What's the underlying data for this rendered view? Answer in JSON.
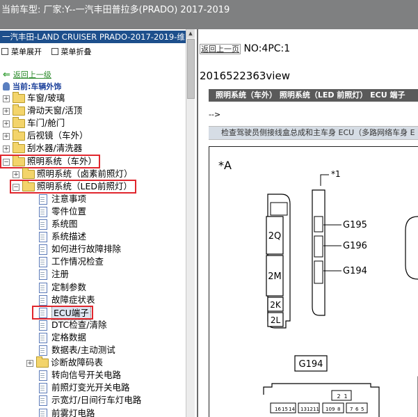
{
  "window": {
    "title": "当前车型:   厂家:Y--一汽丰田普拉多(PRADO) 2017-2019"
  },
  "left_panel": {
    "header": "一汽丰田-LAND CRUISER PRADO-2017-2019-维",
    "toolbar": {
      "expand": "菜单展开",
      "collapse": "菜单折叠"
    },
    "back_label": "返回上一级",
    "current_label": "当前:车辆外饰",
    "tree": [
      {
        "label": "车窗/玻璃",
        "type": "folder",
        "level": 0,
        "expander": "+"
      },
      {
        "label": "滑动天窗/活顶",
        "type": "folder",
        "level": 0,
        "expander": "+"
      },
      {
        "label": "车门/舱门",
        "type": "folder",
        "level": 0,
        "expander": "+"
      },
      {
        "label": "后视镜（车外）",
        "type": "folder",
        "level": 0,
        "expander": "+"
      },
      {
        "label": "刮水器/清洗器",
        "type": "folder",
        "level": 0,
        "expander": "+"
      },
      {
        "label": "照明系统（车外）",
        "type": "folder",
        "level": 0,
        "expander": "-",
        "highlight": true
      },
      {
        "label": "照明系统（卤素前照灯）",
        "type": "folder",
        "level": 1,
        "expander": "+"
      },
      {
        "label": "照明系统（LED前照灯）",
        "type": "folder",
        "level": 1,
        "expander": "-",
        "highlight": true
      },
      {
        "label": "注意事项",
        "type": "doc",
        "level": 2
      },
      {
        "label": "零件位置",
        "type": "doc",
        "level": 2
      },
      {
        "label": "系统图",
        "type": "doc",
        "level": 2
      },
      {
        "label": "系统描述",
        "type": "doc",
        "level": 2
      },
      {
        "label": "如何进行故障排除",
        "type": "doc",
        "level": 2
      },
      {
        "label": "工作情况检查",
        "type": "doc",
        "level": 2
      },
      {
        "label": "注册",
        "type": "doc",
        "level": 2
      },
      {
        "label": "定制参数",
        "type": "doc",
        "level": 2
      },
      {
        "label": "故障症状表",
        "type": "doc",
        "level": 2
      },
      {
        "label": "ECU端子",
        "type": "doc",
        "level": 2,
        "highlight": true,
        "selected": true
      },
      {
        "label": "DTC检查/清除",
        "type": "doc",
        "level": 2
      },
      {
        "label": "定格数据",
        "type": "doc",
        "level": 2
      },
      {
        "label": "数据表/主动测试",
        "type": "doc",
        "level": 2
      },
      {
        "label": "诊断故障码表",
        "type": "folder",
        "level": 2,
        "expander": "+"
      },
      {
        "label": "转向信号开关电路",
        "type": "doc",
        "level": 2
      },
      {
        "label": "前照灯变光开关电路",
        "type": "doc",
        "level": 2
      },
      {
        "label": "示宽灯/日间行车灯电路",
        "type": "doc",
        "level": 2
      },
      {
        "label": "前雾灯电路",
        "type": "doc",
        "level": 2
      }
    ]
  },
  "right_panel": {
    "back_link": "返回上一页",
    "no_label": "NO:4PC:1",
    "doc_id": "2016522363view",
    "section_title": "照明系统（车外） 照明系统（LED 前照灯） ECU 端子",
    "arrow_text": "-->",
    "sub_title": "检查驾驶员侧接线盒总成和主车身 ECU（多路网络车身 E",
    "diagram": {
      "label_a": "*A",
      "label_1": "*1",
      "relays": [
        "2Q",
        "2M",
        "2K",
        "2L"
      ],
      "connectors": [
        "G195",
        "G196",
        "G194"
      ],
      "bottom_connector": "G194",
      "pin_numbers_left": [
        "16",
        "15",
        "14",
        "13",
        "12",
        "11",
        "10",
        "9",
        "8",
        "7",
        "6",
        "5"
      ],
      "pin_numbers_right": [
        "2",
        "1"
      ]
    }
  }
}
